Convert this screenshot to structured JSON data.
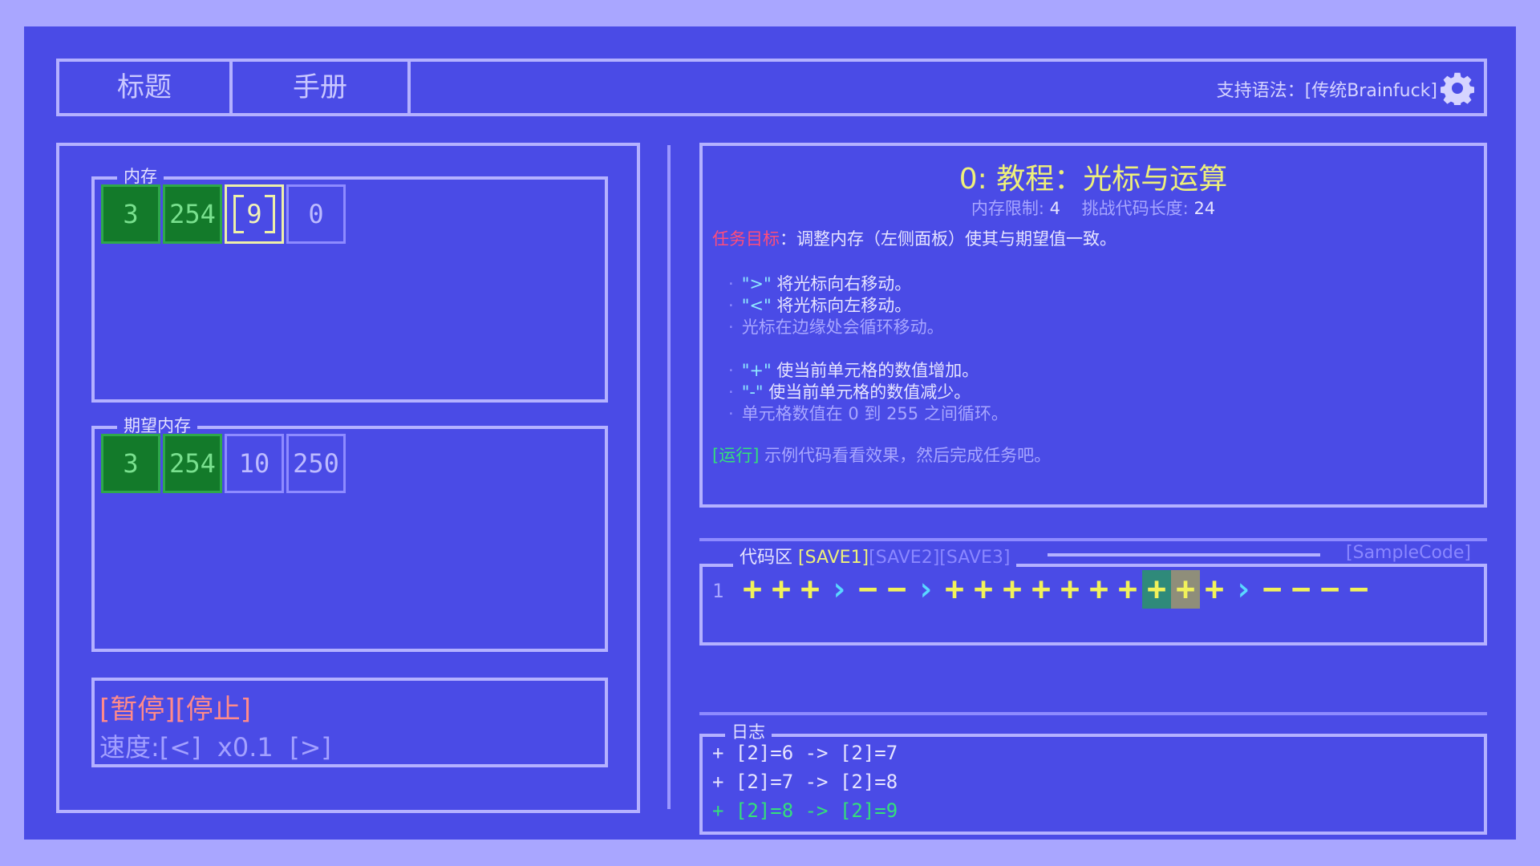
{
  "header": {
    "tabs": [
      "标题",
      "手册"
    ],
    "syntax_label": "支持语法：[传统Brainfuck]",
    "settings_icon": "gear-icon"
  },
  "memory": {
    "label": "内存",
    "cells": [
      "3",
      "254",
      "9",
      "0"
    ]
  },
  "expected_memory": {
    "label": "期望内存",
    "cells": [
      "3",
      "254",
      "10",
      "250"
    ]
  },
  "controls": {
    "pause": "[暂停]",
    "stop": "[停止]",
    "speed_label": "速度:",
    "speed_down": "[<]",
    "speed_value": "x0.1",
    "speed_up": "[>]"
  },
  "task": {
    "title": "0: 教程：光标与运算",
    "memory_limit_label": "内存限制:",
    "memory_limit": "4",
    "code_length_label": "挑战代码长度:",
    "code_length": "24",
    "goal_tag": "任务目标",
    "goal_text": "：调整内存（左侧面板）使其与期望值一致。",
    "hints": [
      {
        "key": "\">\"",
        "text": " 将光标向右移动。"
      },
      {
        "key": "\"<\"",
        "text": " 将光标向左移动。"
      },
      {
        "key": "",
        "text": "光标在边缘处会循环移动。"
      },
      {
        "key": "\"+\"",
        "text": " 使当前单元格的数值增加。"
      },
      {
        "key": "\"-\"",
        "text": " 使当前单元格的数值减少。"
      },
      {
        "key": "",
        "text": "单元格数值在 0 到 255 之间循环。"
      }
    ],
    "run_tag": "[运行]",
    "run_text": " 示例代码看看效果，然后完成任务吧。"
  },
  "code": {
    "label": "代码区",
    "saves": [
      "[SAVE1]",
      "[SAVE2]",
      "[SAVE3]"
    ],
    "sample": "[SampleCode]",
    "line_number": "1",
    "tokens": [
      "+",
      "+",
      "+",
      ">",
      "-",
      "-",
      ">",
      "+",
      "+",
      "+",
      "+",
      "+",
      "+",
      "+",
      "+",
      "+",
      "+",
      ">",
      "-",
      "-",
      "-",
      "-"
    ]
  },
  "log": {
    "label": "日志",
    "lines": [
      "+ [2]=6 -> [2]=7",
      "+ [2]=7 -> [2]=8",
      "+ [2]=8 -> [2]=9"
    ]
  },
  "colors": {
    "background": "#4a4be6",
    "border": "#b4b1ff",
    "cell_ok": "#137a2a",
    "highlight_yellow": "#f2f25a",
    "accent_cyan": "#5ad8ff",
    "accent_red": "#ff4d7a",
    "accent_green": "#34e07a"
  }
}
